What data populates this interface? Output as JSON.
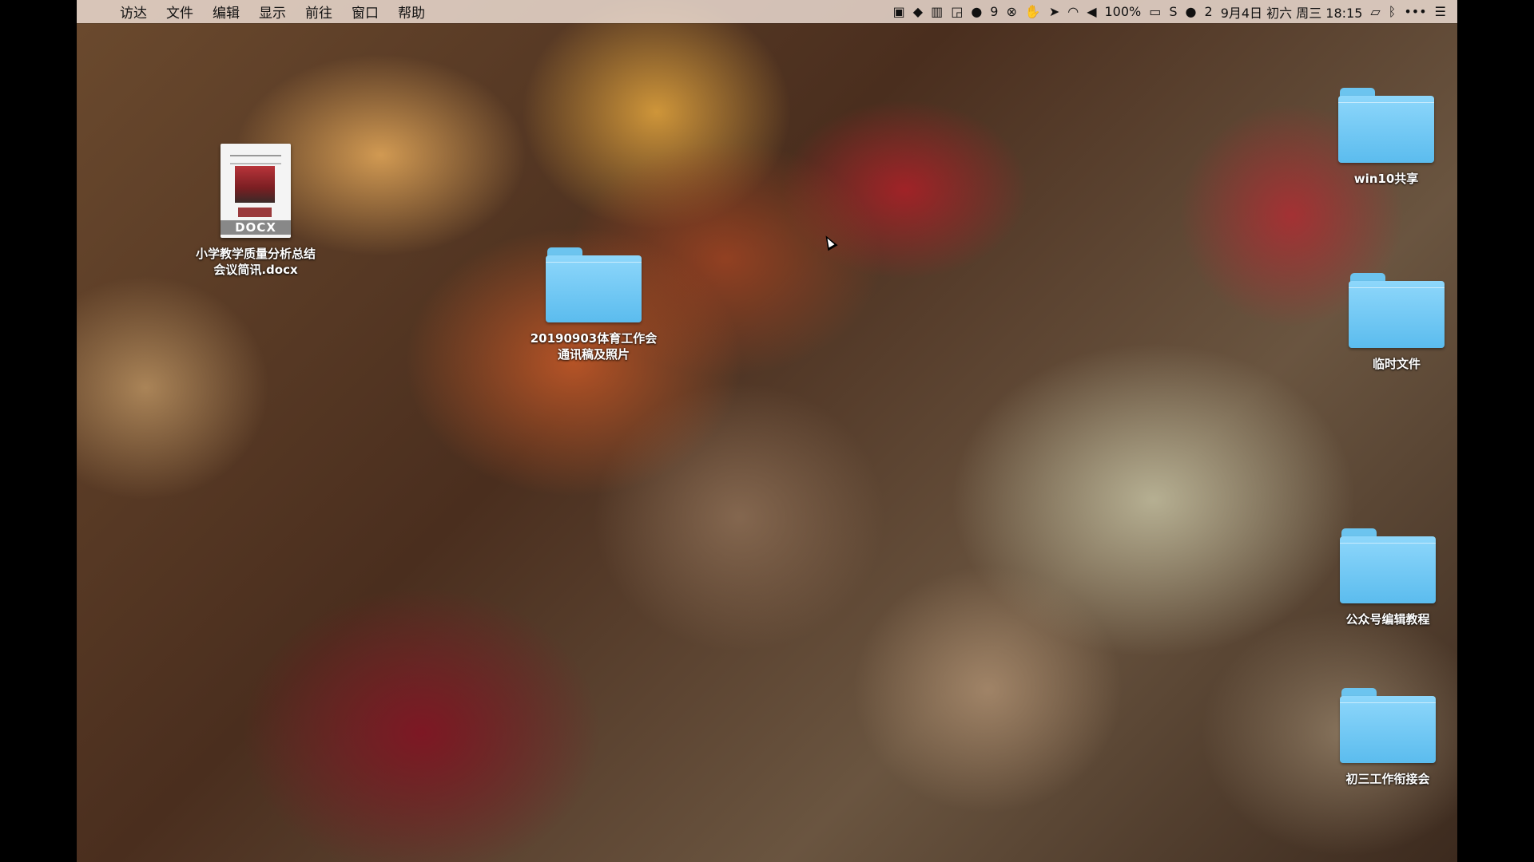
{
  "menubar": {
    "apple_icon": "apple-icon",
    "menus": [
      "访达",
      "文件",
      "编辑",
      "显示",
      "前往",
      "窗口",
      "帮助"
    ],
    "status": {
      "notification_count": "9",
      "battery_percent": "100%",
      "wechat_count": "2",
      "date_time": "9月4日 初六 周三 18:15"
    }
  },
  "desktop": {
    "items": [
      {
        "name": "小学教学质量分析总结会议简讯.docx",
        "type": "document",
        "ext_label": "DOCX"
      },
      {
        "name": "20190903体育工作会通讯稿及照片",
        "type": "folder"
      },
      {
        "name": "win10共享",
        "type": "folder"
      },
      {
        "name": "临时文件",
        "type": "folder"
      },
      {
        "name": "公众号编辑教程",
        "type": "folder"
      },
      {
        "name": "初三工作衔接会",
        "type": "folder"
      }
    ]
  },
  "colors": {
    "folder": "#6cc4ef",
    "menubar": "#f0e1d7"
  }
}
